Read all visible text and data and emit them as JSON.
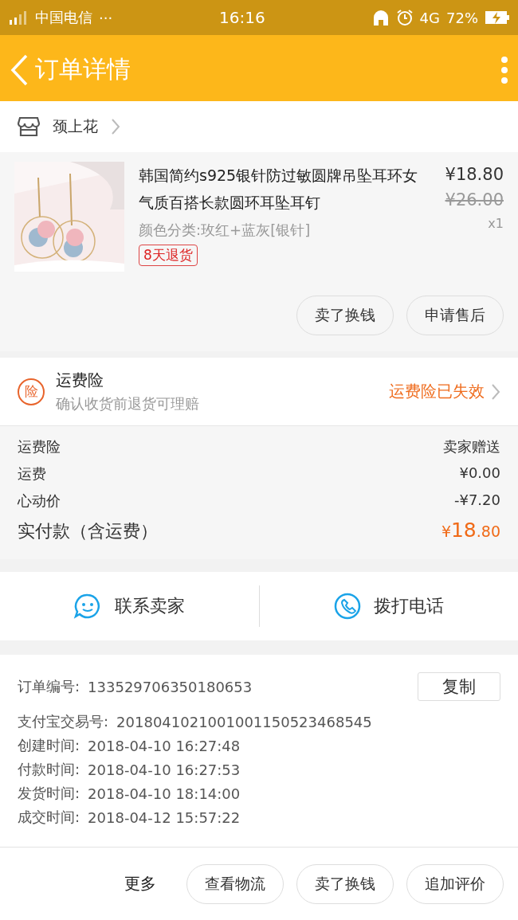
{
  "status_bar": {
    "carrier": "中国电信",
    "dots": "···",
    "time": "16:16",
    "network": "4G",
    "battery": "72%"
  },
  "header": {
    "title": "订单详情"
  },
  "shop": {
    "name": "颈上花"
  },
  "product": {
    "image": {
      "kind": "picture"
    },
    "title": "韩国简约s925银针防过敏圆牌吊坠耳环女气质百搭长款圆环耳坠耳钉",
    "price": "¥18.80",
    "original_price": "¥26.00",
    "quantity": "x1",
    "variant": "颜色分类:玫红+蓝灰[银针]",
    "tag": "8天退货",
    "actions": [
      "卖了换钱",
      "申请售后"
    ]
  },
  "insurance": {
    "badge": "险",
    "title": "运费险",
    "subtitle": "确认收货前退货可理赔",
    "status": "运费险已失效"
  },
  "fees": [
    {
      "label": "运费险",
      "value": "卖家赠送"
    },
    {
      "label": "运费",
      "value": "¥0.00"
    },
    {
      "label": "心动价",
      "value": "-¥7.20"
    }
  ],
  "total": {
    "label": "实付款（含运费）",
    "value": "¥18.80"
  },
  "contact": [
    {
      "kind": "chat",
      "label": "联系卖家"
    },
    {
      "kind": "phone",
      "label": "拨打电话"
    }
  ],
  "order_info": {
    "copy_button": "复制",
    "rows": [
      {
        "label": "订单编号:",
        "value": "133529706350180653"
      },
      {
        "label": "支付宝交易号:",
        "value": "2018041021001001150523468545"
      },
      {
        "label": "创建时间:",
        "value": "2018-04-10 16:27:48"
      },
      {
        "label": "付款时间:",
        "value": "2018-04-10 16:27:53"
      },
      {
        "label": "发货时间:",
        "value": "2018-04-10 18:14:00"
      },
      {
        "label": "成交时间:",
        "value": "2018-04-12 15:57:22"
      }
    ]
  },
  "bottom_bar": {
    "more": "更多",
    "buttons": [
      "查看物流",
      "卖了换钱",
      "追加评价"
    ]
  }
}
